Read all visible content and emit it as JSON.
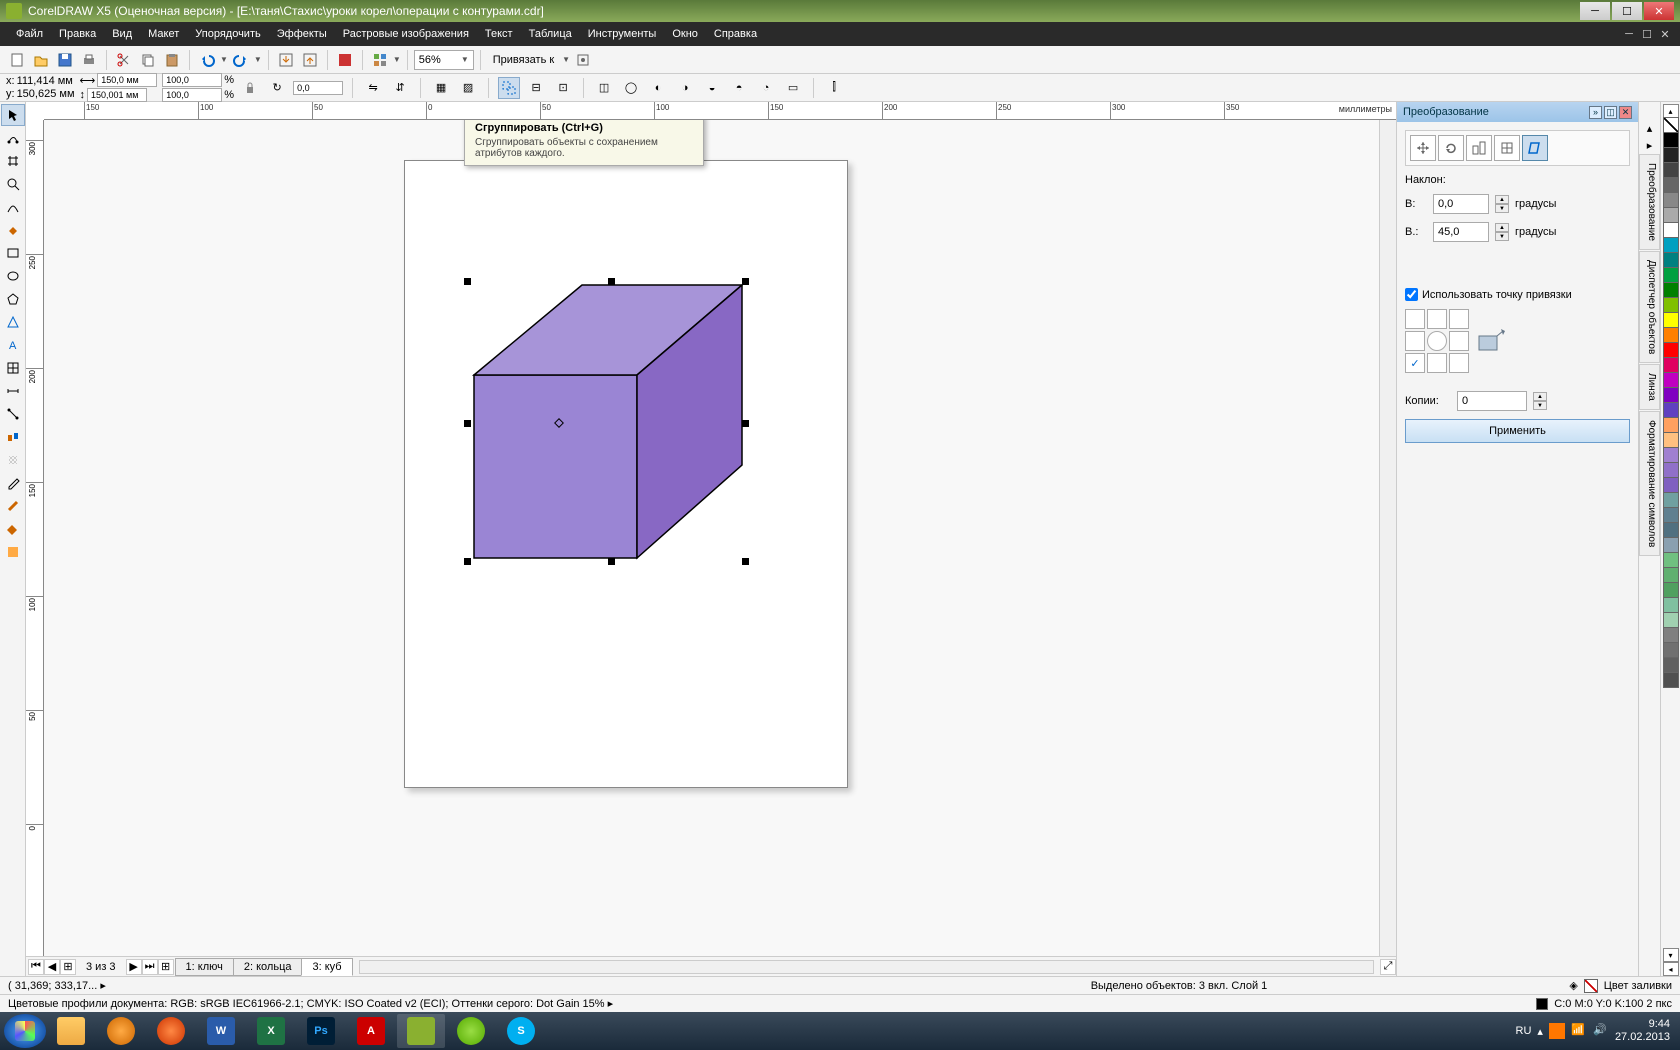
{
  "title": "CorelDRAW X5 (Оценочная версия) - [E:\\таня\\Стахис\\уроки корел\\операции с контурами.cdr]",
  "menu": [
    "Файл",
    "Правка",
    "Вид",
    "Макет",
    "Упорядочить",
    "Эффекты",
    "Растровые изображения",
    "Текст",
    "Таблица",
    "Инструменты",
    "Окно",
    "Справка"
  ],
  "toolbar": {
    "zoom": "56%",
    "snap_label": "Привязать к"
  },
  "propbar": {
    "x_label": "x:",
    "x_val": "111,414 мм",
    "y_label": "y:",
    "y_val": "150,625 мм",
    "w_val": "150,0 мм",
    "h_val": "150,001 мм",
    "sx": "100,0",
    "sy": "100,0",
    "pct": "%",
    "angle": "0,0"
  },
  "ruler_unit": "миллиметры",
  "hruler_ticks": [
    "150",
    "100",
    "50",
    "0",
    "50",
    "100",
    "150",
    "200",
    "250",
    "300",
    "350"
  ],
  "vruler_ticks": [
    "300",
    "250",
    "200",
    "150",
    "100",
    "50",
    "0"
  ],
  "tooltip": {
    "title": "Сгруппировать (Ctrl+G)",
    "body": "Сгруппировать объекты с сохранением атрибутов каждого."
  },
  "pages": {
    "count_label": "3 из 3",
    "tabs": [
      "1: ключ",
      "2: кольца",
      "3: куб"
    ],
    "active": 2
  },
  "panel": {
    "title": "Преобразование",
    "skew_label": "Наклон:",
    "h_label": "В:",
    "h_val": "0,0",
    "h_unit": "градусы",
    "v_label": "В.:",
    "v_val": "45,0",
    "v_unit": "градусы",
    "anchor_label": "Использовать точку привязки",
    "copies_label": "Копии:",
    "copies_val": "0",
    "apply": "Применить"
  },
  "vtabs": [
    "Преобразование",
    "Диспетчер объектов",
    "Линза",
    "Форматирование символов"
  ],
  "palette": [
    "#000000",
    "#222222",
    "#444444",
    "#666666",
    "#888888",
    "#aaaaaa",
    "#ffffff",
    "#00a0c0",
    "#008080",
    "#00a040",
    "#008000",
    "#80c000",
    "#ffff00",
    "#ff8000",
    "#ff0000",
    "#e00060",
    "#c000c0",
    "#8000c0",
    "#6040c0",
    "#ffa060",
    "#ffc080",
    "#a080d0",
    "#9070c8",
    "#8060c0",
    "#70a0a0",
    "#608090",
    "#507080",
    "#8aa0b0",
    "#70c080",
    "#60b070",
    "#50a060",
    "#80c0a0",
    "#a0d0b0",
    "#808080",
    "#707070",
    "#606060",
    "#505050"
  ],
  "status1": {
    "left": "( 31,369; 333,17... ▸",
    "center": "Выделено объектов: 3 вкл. Слой 1",
    "fill_label": "Цвет заливки"
  },
  "status2": {
    "left": "Цветовые профили документа: RGB: sRGB IEC61966-2.1; CMYK: ISO Coated v2 (ECI); Оттенки серого: Dot Gain 15% ▸",
    "right": "C:0 M:0 Y:0 K:100  2 пкс"
  },
  "tray": {
    "lang": "RU",
    "time": "9:44",
    "date": "27.02.2013"
  }
}
